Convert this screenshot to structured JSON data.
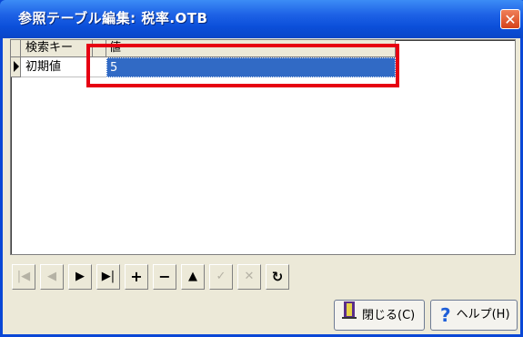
{
  "window": {
    "title": "参照テーブル編集: 税率.OTB",
    "close_label": "✕"
  },
  "grid": {
    "columns": [
      "検索キー",
      "値"
    ],
    "rows": [
      {
        "key": "初期値",
        "value": "5"
      }
    ]
  },
  "navigator": {
    "buttons": [
      {
        "name": "first",
        "glyph": "|◀",
        "enabled": false
      },
      {
        "name": "prior",
        "glyph": "◀",
        "enabled": false
      },
      {
        "name": "next",
        "glyph": "▶",
        "enabled": true
      },
      {
        "name": "last",
        "glyph": "▶|",
        "enabled": true
      },
      {
        "name": "insert",
        "glyph": "+",
        "enabled": true
      },
      {
        "name": "delete",
        "glyph": "−",
        "enabled": true
      },
      {
        "name": "edit",
        "glyph": "▲",
        "enabled": true
      },
      {
        "name": "post",
        "glyph": "✓",
        "enabled": false
      },
      {
        "name": "cancel",
        "glyph": "✕",
        "enabled": false
      },
      {
        "name": "refresh",
        "glyph": "↻",
        "enabled": true
      }
    ]
  },
  "buttons": {
    "close": "閉じる(C)",
    "help": "ヘルプ(H)"
  },
  "icons": {
    "close_icon": "door-icon",
    "help_icon": "question-mark-icon"
  },
  "colors": {
    "title_bar": "#0A47D6",
    "selection": "#316AC5",
    "highlight_box": "#E60012"
  }
}
